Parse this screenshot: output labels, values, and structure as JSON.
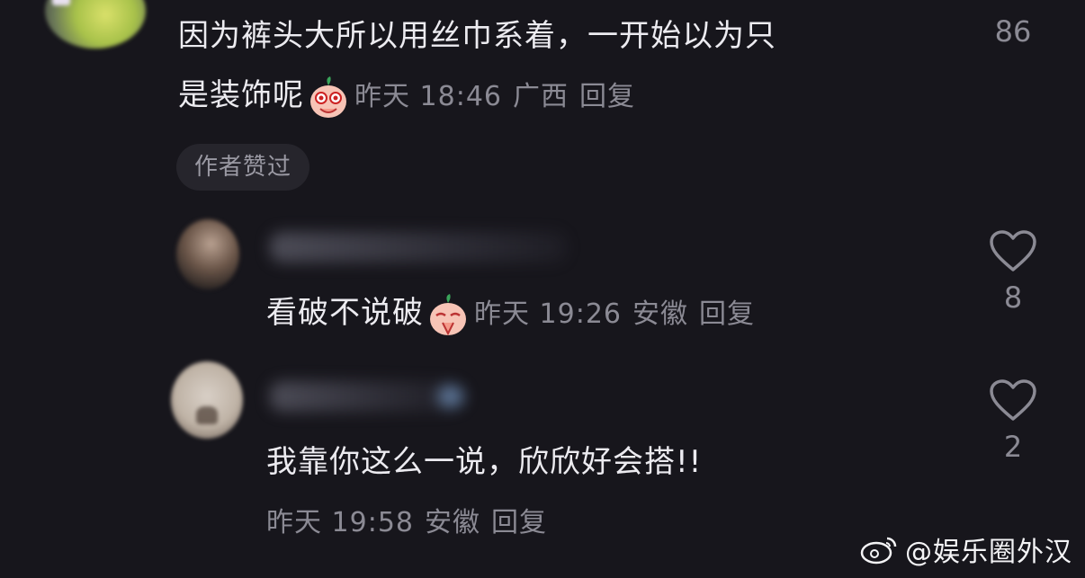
{
  "comments": [
    {
      "line1": "因为裤头大所以用丝巾系着，一开始以为只",
      "line2": "是装饰呢",
      "emoji": "shy-peach-emoji",
      "time": "昨天 18:46",
      "location": "广西",
      "reply_label": "回复",
      "tag": "作者赞过",
      "likes": "86"
    },
    {
      "text": "看破不说破",
      "emoji": "praying-peach-emoji",
      "time": "昨天 19:26",
      "location": "安徽",
      "reply_label": "回复",
      "likes": "8"
    },
    {
      "text": "我靠你这么一说，欣欣好会搭!!",
      "time": "昨天 19:58",
      "location": "安徽",
      "reply_label": "回复",
      "likes": "2"
    }
  ],
  "watermark": {
    "text": "@娱乐圈外汉",
    "icon": "weibo-icon"
  },
  "colors": {
    "background": "#17161c",
    "text_primary": "#ecebf0",
    "text_secondary": "#8b8a94",
    "tag_bg": "#26252c"
  }
}
